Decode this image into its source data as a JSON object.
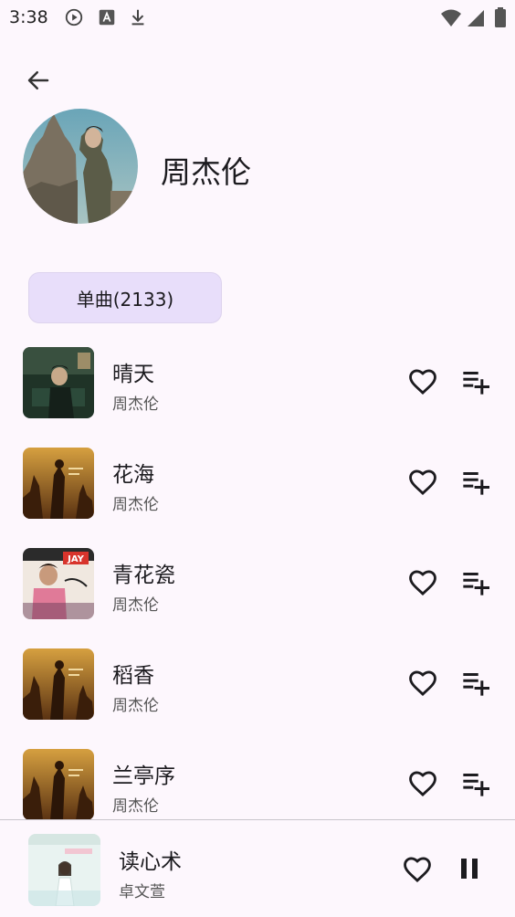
{
  "status_bar": {
    "time": "3:38",
    "icons": [
      "play-circle-icon",
      "font-a-icon",
      "download-icon",
      "wifi-icon",
      "signal-icon",
      "battery-icon"
    ]
  },
  "header": {
    "back_icon": "arrow-back-icon",
    "artist_name": "周杰伦"
  },
  "filter": {
    "label": "单曲(2133)"
  },
  "songs": [
    {
      "title": "晴天",
      "artist": "周杰伦",
      "cover": "dark-green"
    },
    {
      "title": "花海",
      "artist": "周杰伦",
      "cover": "golden"
    },
    {
      "title": "青花瓷",
      "artist": "周杰伦",
      "cover": "pink-jay"
    },
    {
      "title": "稻香",
      "artist": "周杰伦",
      "cover": "golden"
    },
    {
      "title": "兰亭序",
      "artist": "周杰伦",
      "cover": "golden"
    }
  ],
  "now_playing": {
    "title": "读心术",
    "artist": "卓文萱"
  },
  "colors": {
    "background": "#fdf7fd",
    "chip": "#e8defa",
    "text_primary": "#1c1b1f",
    "text_secondary": "#555555"
  }
}
